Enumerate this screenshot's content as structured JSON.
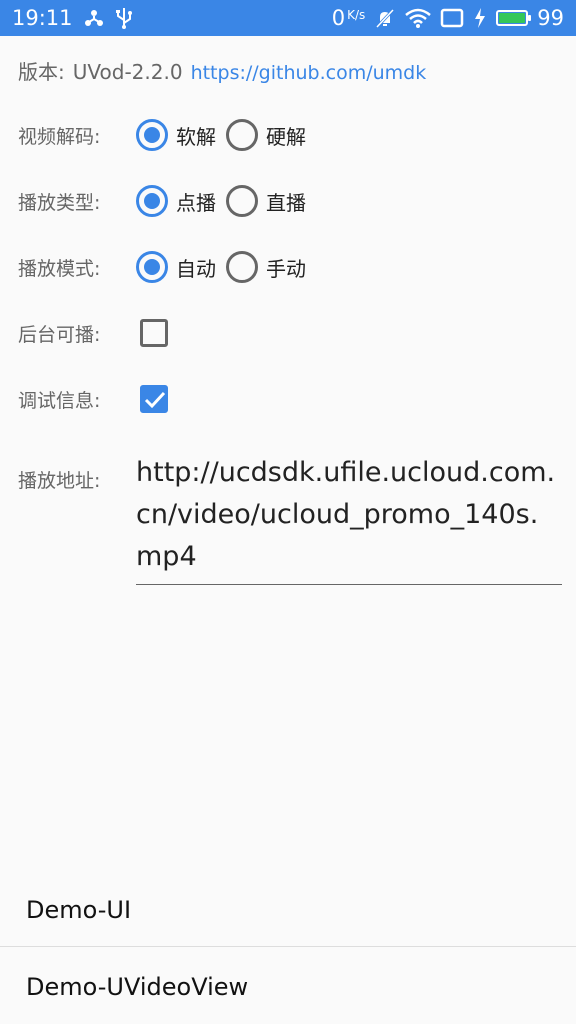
{
  "status_bar": {
    "time": "19:11",
    "speed_value": "0",
    "speed_unit": "K/s",
    "battery": "99",
    "battery_level": 0.99,
    "left_icons": [
      "usb-tethering-icon",
      "usb-icon"
    ],
    "right_icons": [
      "mute-icon",
      "wifi-icon",
      "screen-icon",
      "charging-icon",
      "battery-icon"
    ],
    "colors": {
      "bar": "#3a86e6",
      "battery": "#34c759"
    }
  },
  "version": {
    "label": "版本:",
    "value": "UVod-2.2.0",
    "link": "https://github.com/umdk"
  },
  "options": {
    "decode": {
      "label": "视频解码:",
      "choices": [
        "软解",
        "硬解"
      ],
      "selected": "软解"
    },
    "play_type": {
      "label": "播放类型:",
      "choices": [
        "点播",
        "直播"
      ],
      "selected": "点播"
    },
    "play_mode": {
      "label": "播放模式:",
      "choices": [
        "自动",
        "手动"
      ],
      "selected": "自动"
    },
    "background_play": {
      "label": "后台可播:",
      "checked": false
    },
    "debug_info": {
      "label": "调试信息:",
      "checked": true
    }
  },
  "address": {
    "label": "播放地址:",
    "value": "http://ucdsdk.ufile.ucloud.com.cn/video/ucloud_promo_140s.mp4"
  },
  "list": [
    {
      "label": "Demo-UI"
    },
    {
      "label": "Demo-UVideoView"
    }
  ],
  "accent_color": "#3a86e6"
}
